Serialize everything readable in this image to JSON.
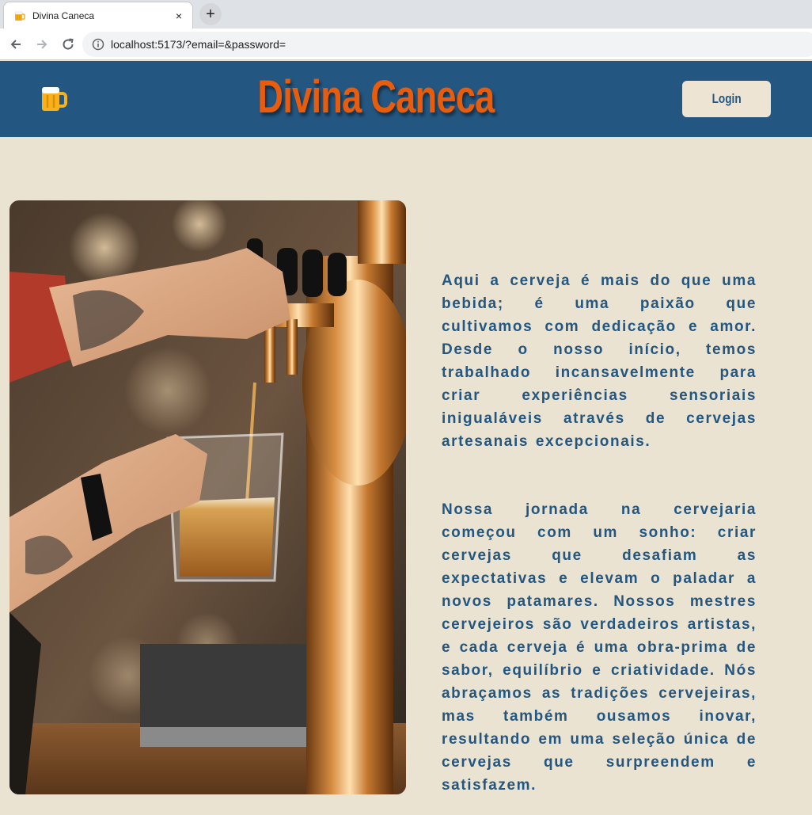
{
  "browser": {
    "tab_title": "Divina Caneca",
    "tab_close": "×",
    "new_tab": "+",
    "url": "localhost:5173/?email=&password="
  },
  "header": {
    "logo_icon": "beer-mug-icon",
    "title": "Divina Caneca",
    "login_label": "Login"
  },
  "main": {
    "image_alt": "bartender pouring beer from tap",
    "paragraphs": [
      "Aqui a cerveja é mais do que uma bebida; é uma paixão que cultivamos com dedicação e amor. Desde o nosso início, temos trabalhado incansavelmente para criar experiências sensoriais inigualáveis através de cervejas artesanais excepcionais.",
      "Nossa jornada na cervejaria começou com um sonho: criar cervejas que desafiam as expectativas e elevam o paladar a novos patamares. Nossos mestres cervejeiros são verdadeiros artistas, e cada cerveja é uma obra-prima de sabor, equilíbrio e criatividade. Nós abraçamos as tradições cervejeiras, mas também ousamos inovar, resultando em uma seleção única de cervejas que surpreendem e satisfazem."
    ]
  },
  "colors": {
    "header_bg": "#235680",
    "title": "#e85c0d",
    "page_bg": "#ebe3d1",
    "text": "#235680"
  }
}
